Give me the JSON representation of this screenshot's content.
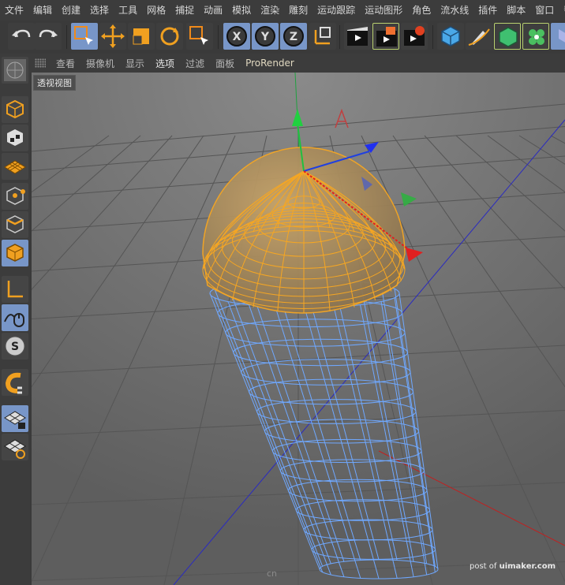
{
  "menu": [
    "文件",
    "编辑",
    "创建",
    "选择",
    "工具",
    "网格",
    "捕捉",
    "动画",
    "模拟",
    "渲染",
    "雕刻",
    "运动跟踪",
    "运动图形",
    "角色",
    "流水线",
    "插件",
    "脚本",
    "窗口",
    "帮"
  ],
  "toolbar": {
    "icons": [
      "undo-icon",
      "redo-icon",
      "live-selection-icon",
      "move-icon",
      "scale-icon",
      "rotate-icon",
      "recent-tool-icon",
      "x-axis-icon",
      "y-axis-icon",
      "z-axis-icon",
      "coordinate-system-icon",
      "render-view-icon",
      "render-to-picture-viewer-icon",
      "render-settings-icon",
      "cube-icon",
      "pen-icon",
      "subdivision-surface-icon",
      "cloner-icon",
      "deformer-icon"
    ],
    "axis_labels": [
      "X",
      "Y",
      "Z"
    ]
  },
  "sidebar": {
    "icons": [
      "make-editable-icon",
      "model-mode-icon",
      "texture-mode-icon",
      "points-mode-icon",
      "edges-mode-icon",
      "polygons-mode-icon",
      "axis-mode-icon",
      "tweak-mode-icon",
      "solo-icon",
      "snap-icon",
      "workplane-lock-icon",
      "workplane-icon"
    ],
    "solo_label": "S"
  },
  "viewport_menu": {
    "items": [
      "查看",
      "摄像机",
      "显示",
      "选项",
      "过滤",
      "面板",
      "ProRender"
    ],
    "active": "选项"
  },
  "viewport": {
    "label": "透视视图",
    "watermark_post": "post of",
    "watermark_site": "uimaker.com",
    "watermark_logo": "cn"
  },
  "colors": {
    "accent_active": "#7896c8",
    "selection_orange": "#f5a623",
    "wire_blue": "#6fa8ff",
    "axis_x": "#e02020",
    "axis_y": "#20c040",
    "axis_z": "#2040e0"
  }
}
